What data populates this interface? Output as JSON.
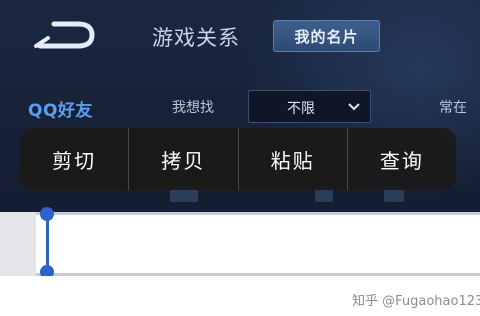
{
  "header": {
    "title": "游戏关系",
    "card_button": "我的名片"
  },
  "tabs": {
    "qq_friends": "QQ好友"
  },
  "filter": {
    "find_label": "我想找",
    "select_value": "不限",
    "right_label": "常在"
  },
  "context_menu": {
    "items": [
      "剪切",
      "拷贝",
      "粘贴",
      "查询"
    ]
  },
  "watermark": "知乎 @Fugaohao123",
  "colors": {
    "accent": "#5aa0ee",
    "selection_handle": "#2f62c9",
    "menu_bg": "#1a1a1a"
  }
}
